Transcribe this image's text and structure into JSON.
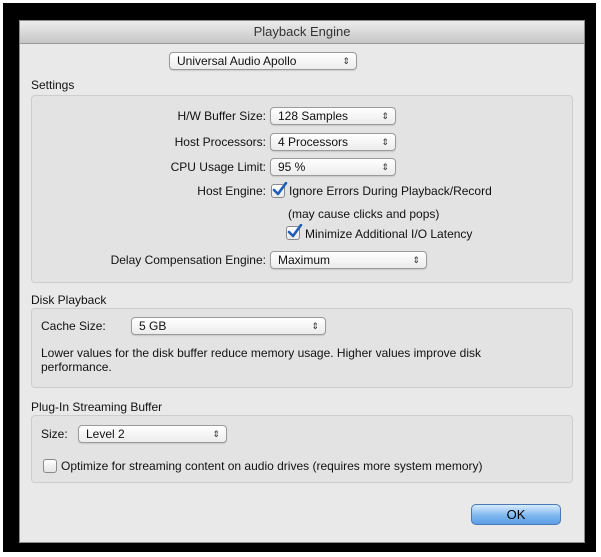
{
  "window": {
    "title": "Playback Engine"
  },
  "device": {
    "selected": "Universal Audio Apollo"
  },
  "settings": {
    "header": "Settings",
    "hw_buffer": {
      "label": "H/W Buffer Size:",
      "value": "128 Samples"
    },
    "host_processors": {
      "label": "Host Processors:",
      "value": "4 Processors"
    },
    "cpu_limit": {
      "label": "CPU Usage Limit:",
      "value": "95 %"
    },
    "host_engine": {
      "label": "Host Engine:",
      "ignore_errors": {
        "label": "Ignore Errors During Playback/Record",
        "checked": true
      },
      "note": "(may cause clicks and pops)",
      "minimize_latency": {
        "label": "Minimize Additional I/O Latency",
        "checked": true
      }
    },
    "delay_comp": {
      "label": "Delay Compensation Engine:",
      "value": "Maximum"
    }
  },
  "disk": {
    "header": "Disk Playback",
    "cache": {
      "label": "Cache Size:",
      "value": "5 GB"
    },
    "description": "Lower values for the disk buffer reduce memory usage.  Higher values improve disk performance."
  },
  "plugin": {
    "header": "Plug-In Streaming Buffer",
    "size": {
      "label": "Size:",
      "value": "Level 2"
    },
    "optimize": {
      "label": "Optimize for streaming content on audio drives (requires more system memory)",
      "checked": false
    }
  },
  "buttons": {
    "ok": "OK"
  },
  "icons": {
    "popup_arrows": "⌃⌄",
    "checkmark": "check-icon"
  },
  "colors": {
    "ok_button": "#6aa8ea",
    "check": "#1f5fb8"
  }
}
